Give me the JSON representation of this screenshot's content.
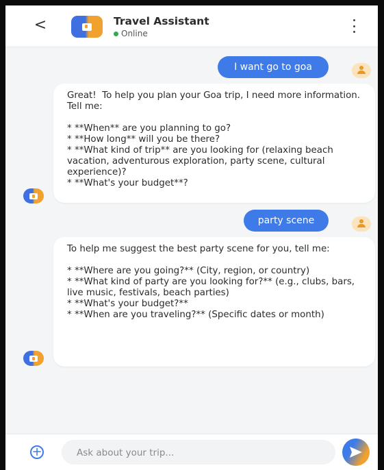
{
  "header": {
    "back_glyph": "<",
    "title": "Travel Assistant",
    "status": "Online",
    "status_color": "#34a853"
  },
  "messages": [
    {
      "role": "user",
      "text": "I want go to goa"
    },
    {
      "role": "assistant",
      "text": "Great!  To help you plan your Goa trip, I need more information.  Tell me:\n\n* **When** are you planning to go?\n* **How long** will you be there?\n* **What kind of trip** are you looking for (relaxing beach vacation, adventurous exploration, party scene, cultural experience)?\n* **What's your budget**?"
    },
    {
      "role": "user",
      "text": "party scene"
    },
    {
      "role": "assistant",
      "text": "To help me suggest the best party scene for you, tell me:\n\n* **Where are you going?** (City, region, or country)\n* **What kind of party are you looking for?** (e.g., clubs, bars, live music, festivals, beach parties)\n* **What's your budget?**\n* **When are you traveling?** (Specific dates or month)"
    }
  ],
  "composer": {
    "add_glyph": "+",
    "placeholder": "Ask about your trip..."
  },
  "colors": {
    "accent_blue": "#3e7be8",
    "accent_orange": "#f0a12e"
  },
  "icons": {
    "back": "chevron-left-icon",
    "bot": "assistant-icon",
    "user": "user-icon",
    "more": "more-vertical-icon",
    "add": "add-circle-icon",
    "send": "send-icon"
  }
}
